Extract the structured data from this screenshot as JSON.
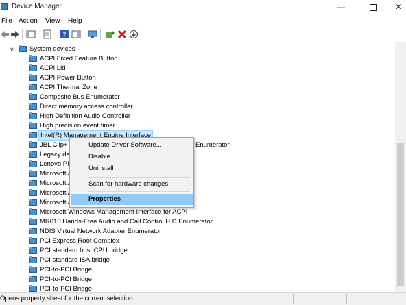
{
  "window": {
    "title": "Device Manager",
    "minimize_glyph": "—",
    "close_glyph": "✕"
  },
  "menu": [
    "File",
    "Action",
    "View",
    "Help"
  ],
  "toolbar": {
    "icons": [
      "back-icon",
      "forward-icon",
      "show-hide-console-tree-icon",
      "properties-icon",
      "help-icon",
      "action-pane-icon",
      "monitor-icon",
      "update-driver-icon",
      "uninstall-icon",
      "scan-hardware-icon"
    ]
  },
  "tree": {
    "category": {
      "label": "System devices",
      "expander": "∨"
    },
    "devices": [
      "ACPI Fixed Feature Button",
      "ACPI Lid",
      "ACPI Power Button",
      "ACPI Thermal Zone",
      "Composite Bus Enumerator",
      "Direct memory access controller",
      "High Definition Audio Controller",
      "High precision event timer",
      "Intel(R) Management Engine Interface",
      "JBL Clip+ H",
      "Legacy dev",
      "Lenovo PN",
      "Microsoft A",
      "Microsoft A",
      "Microsoft A",
      "Microsoft A",
      "Microsoft Windows Management Interface for ACPI",
      "MR010 Hands-Free Audio and Call Control HID Enumerator",
      "NDIS Virtual Network Adapter Enumerator",
      "PCI Express Root Complex",
      "PCI standard host CPU bridge",
      "PCI standard ISA bridge",
      "PCI-to-PCI Bridge",
      "PCI-to-PCI Bridge",
      "PCI-to-PCI Bridge"
    ],
    "selected_index": 8,
    "partial_text_behind_menu": "Enumerator"
  },
  "context_menu": {
    "items": [
      "Update Driver Software...",
      "Disable",
      "Uninstall",
      "Scan for hardware changes",
      "Properties"
    ],
    "highlighted": "Properties"
  },
  "status_bar": {
    "text": "Opens property sheet for the current selection."
  },
  "colors": {
    "selection": "#cce8ff",
    "menu_highlight": "#91c9f7",
    "folder_icon": "#4f8fc8"
  }
}
